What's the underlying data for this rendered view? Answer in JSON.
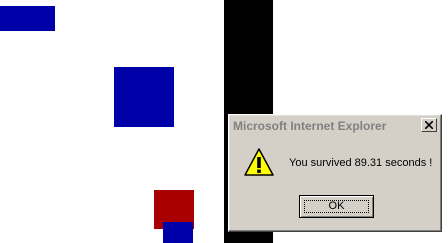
{
  "game": {
    "colors": {
      "background": "#ffffff",
      "wall": "#000000",
      "enemy_block": "#0000a8",
      "player_block": "#a80000"
    }
  },
  "dialog": {
    "title": "Microsoft Internet Explorer",
    "message": "You survived 89.31 seconds !",
    "ok_label": "OK",
    "icon": "warning-icon",
    "close_icon": "close-icon",
    "colors": {
      "face": "#d4d0c8",
      "title_text": "#808080",
      "warning_fill": "#ffff00"
    }
  }
}
